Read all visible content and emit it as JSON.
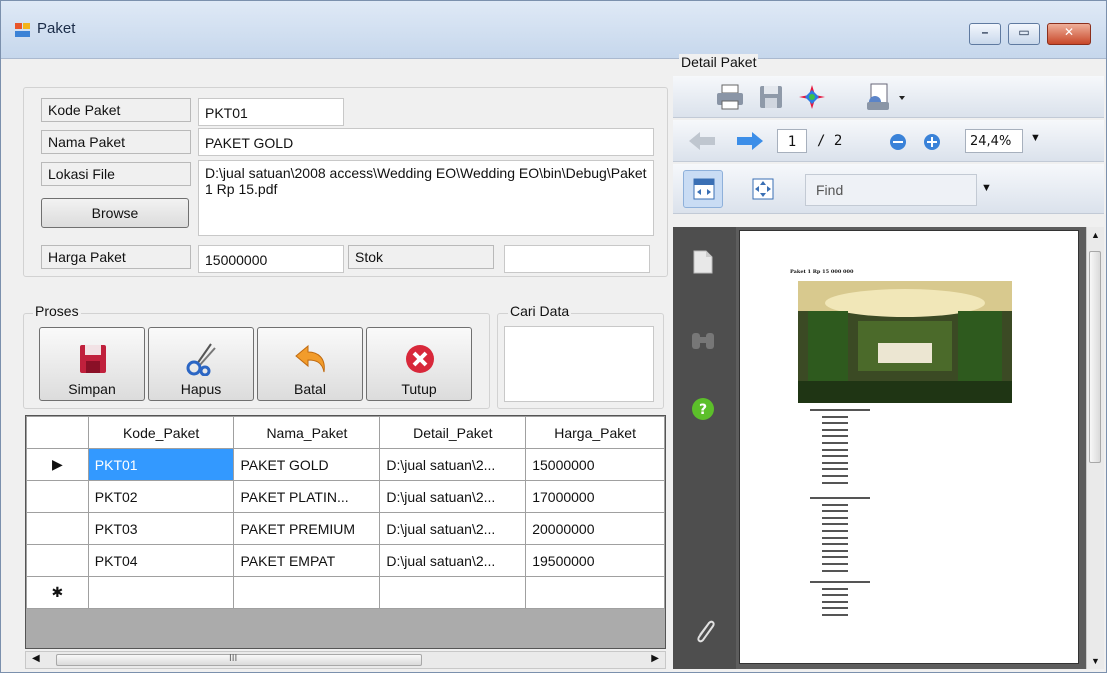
{
  "window": {
    "title": "Paket",
    "buttons": {
      "minimize": "–",
      "maximize": "▭",
      "close": "✕"
    }
  },
  "form": {
    "kode_label": "Kode Paket",
    "kode_value": "PKT01",
    "nama_label": "Nama Paket",
    "nama_value": "PAKET GOLD",
    "lokasi_label": "Lokasi File",
    "lokasi_value": "D:\\jual satuan\\2008 access\\Wedding EO\\Wedding EO\\bin\\Debug\\Paket 1 Rp 15.pdf",
    "browse_label": "Browse",
    "harga_label": "Harga Paket",
    "harga_value": "15000000",
    "stok_label": "Stok",
    "stok_value": ""
  },
  "proses": {
    "legend": "Proses",
    "buttons": [
      "Simpan",
      "Hapus",
      "Batal",
      "Tutup"
    ]
  },
  "cari": {
    "legend": "Cari Data",
    "value": ""
  },
  "grid": {
    "columns": [
      "Kode_Paket",
      "Nama_Paket",
      "Detail_Paket",
      "Harga_Paket"
    ],
    "rows": [
      [
        "PKT01",
        "PAKET GOLD",
        "D:\\jual satuan\\2...",
        "15000000"
      ],
      [
        "PKT02",
        "PAKET PLATIN...",
        "D:\\jual satuan\\2...",
        "17000000"
      ],
      [
        "PKT03",
        "PAKET PREMIUM",
        "D:\\jual satuan\\2...",
        "20000000"
      ],
      [
        "PKT04",
        "PAKET EMPAT",
        "D:\\jual satuan\\2...",
        "19500000"
      ]
    ],
    "current_marker": "▶",
    "new_row_marker": "✱",
    "scroll_grip": "III"
  },
  "detail": {
    "title": "Detail Paket",
    "page_current": "1",
    "page_total": "/ 2",
    "zoom": "24,4%",
    "find_placeholder": "Find",
    "doc_heading": "Paket 1 Rp 15 000 000"
  }
}
